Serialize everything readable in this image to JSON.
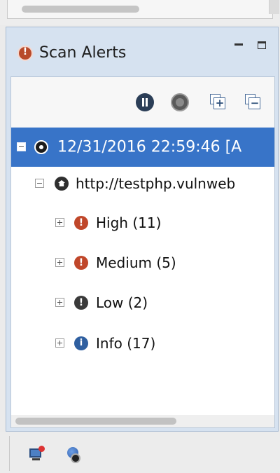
{
  "panel": {
    "tab_label": "Scan Alerts"
  },
  "toolbar": {
    "expand_symbol": "+",
    "collapse_symbol": "−"
  },
  "tree": {
    "scan": {
      "label": "12/31/2016 22:59:46 [A"
    },
    "site": {
      "label": "http://testphp.vulnweb"
    },
    "alerts": [
      {
        "label": "High (11)",
        "color": "#c0472a",
        "icon": "high-alert-icon"
      },
      {
        "label": "Medium (5)",
        "color": "#c0472a",
        "icon": "medium-alert-icon"
      },
      {
        "label": "Low (2)",
        "color": "#3a3a3a",
        "icon": "low-alert-icon"
      },
      {
        "label": "Info (17)",
        "color": "#2f5fa0",
        "icon": "info-icon"
      }
    ]
  },
  "colors": {
    "selection": "#3874c8",
    "view_border": "#a9bcd3"
  }
}
